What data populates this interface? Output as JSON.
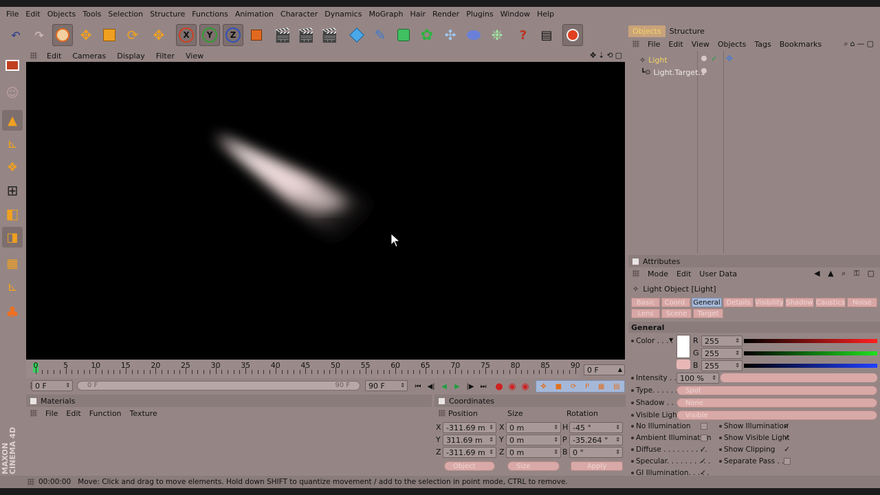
{
  "menu": [
    "File",
    "Edit",
    "Objects",
    "Tools",
    "Selection",
    "Structure",
    "Functions",
    "Animation",
    "Character",
    "Dynamics",
    "MoGraph",
    "Hair",
    "Render",
    "Plugins",
    "Window",
    "Help"
  ],
  "toolbar_axes": [
    "X",
    "Y",
    "Z"
  ],
  "viewport_menu": [
    "Edit",
    "Cameras",
    "Display",
    "Filter",
    "View"
  ],
  "timeline": {
    "labels": [
      "0",
      "5",
      "10",
      "15",
      "20",
      "25",
      "30",
      "35",
      "40",
      "45",
      "50",
      "55",
      "60",
      "65",
      "70",
      "75",
      "80",
      "85",
      "90"
    ],
    "current_frame": "0 F",
    "start_field": "0 F",
    "range_start": "0 F",
    "range_end": "90 F",
    "end_field": "90 F"
  },
  "materials": {
    "title": "Materials",
    "menu": [
      "File",
      "Edit",
      "Function",
      "Texture"
    ]
  },
  "coordinates": {
    "title": "Coordinates",
    "headers": [
      "Position",
      "Size",
      "Rotation"
    ],
    "rows": [
      {
        "axis": "X",
        "pos": "-311.69 m",
        "size_axis": "X",
        "size": "0 m",
        "rot_axis": "H",
        "rot": "-45 °"
      },
      {
        "axis": "Y",
        "pos": "311.69 m",
        "size_axis": "Y",
        "size": "0 m",
        "rot_axis": "P",
        "rot": "-35.264 °"
      },
      {
        "axis": "Z",
        "pos": "-311.69 m",
        "size_axis": "Z",
        "size": "0 m",
        "rot_axis": "B",
        "rot": "0 °"
      }
    ],
    "object_btn": "Object",
    "size_btn": "Size",
    "apply_btn": "Apply"
  },
  "object_manager": {
    "tabs": [
      "Objects",
      "Structure"
    ],
    "menu": [
      "File",
      "Edit",
      "View",
      "Objects",
      "Tags",
      "Bookmarks"
    ],
    "items": [
      "Light",
      "Light.Target.1"
    ]
  },
  "attributes": {
    "title": "Attributes",
    "menu": [
      "Mode",
      "Edit",
      "User Data"
    ],
    "object_title": "Light Object [Light]",
    "tabs_row1": [
      "Basic",
      "Coord.",
      "General",
      "Details",
      "Visibility",
      "Shadow",
      "Caustics",
      "Noise"
    ],
    "tabs_row2": [
      "Lens",
      "Scene",
      "Target"
    ],
    "active_tab": "General",
    "section": "General",
    "color_label": "Color . . . .",
    "rgb": [
      {
        "ch": "R",
        "val": "255"
      },
      {
        "ch": "G",
        "val": "255"
      },
      {
        "ch": "B",
        "val": "255"
      }
    ],
    "intensity_label": "Intensity . . .",
    "intensity_val": "100 %",
    "type_label": "Type. . . . . .",
    "type_val": "Spot",
    "shadow_label": "Shadow . . . .",
    "shadow_val": "None",
    "visible_label": "Visible Light",
    "visible_val": "Visible",
    "checks_left": [
      {
        "label": "No Illumination",
        "checked": false
      },
      {
        "label": "Ambient Illumination",
        "checked": false
      },
      {
        "label": "Diffuse . . . . . . . . . .",
        "checked": true
      },
      {
        "label": "Specular. . . . . . . . . .",
        "checked": true
      },
      {
        "label": "GI Illumination. . . . .",
        "checked": true
      }
    ],
    "checks_right": [
      {
        "label": "Show Illumination",
        "checked": true
      },
      {
        "label": "Show Visible Light",
        "checked": true
      },
      {
        "label": "Show Clipping",
        "checked": true
      },
      {
        "label": "Separate Pass . . .",
        "checked": false
      }
    ]
  },
  "status": {
    "time": "00:00:00",
    "message": "Move: Click and drag to move elements. Hold down SHIFT to quantize movement / add to the selection in point mode, CTRL to remove."
  },
  "branding": "MAXON CINEMA 4D"
}
